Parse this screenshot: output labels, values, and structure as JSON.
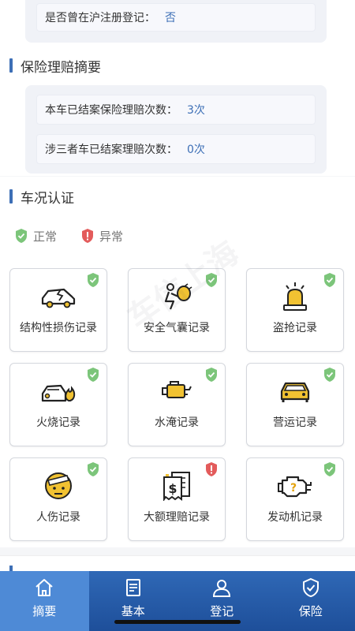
{
  "top_row": {
    "label": "是否曾在沪注册登记：",
    "value": "否"
  },
  "insurance": {
    "title": "保险理赔摘要",
    "rows": [
      {
        "label": "本车已结案保险理赔次数：",
        "value": "3次"
      },
      {
        "label": "涉三者车已结案理赔次数：",
        "value": "0次"
      }
    ]
  },
  "condition": {
    "title": "车况认证",
    "legend": {
      "normal": "正常",
      "abnormal": "异常"
    },
    "tiles": [
      {
        "label": "结构性损伤记录",
        "icon": "car-damage-icon",
        "status": "normal"
      },
      {
        "label": "安全气囊记录",
        "icon": "airbag-icon",
        "status": "normal"
      },
      {
        "label": "盗抢记录",
        "icon": "alarm-light-icon",
        "status": "normal"
      },
      {
        "label": "火烧记录",
        "icon": "car-fire-icon",
        "status": "normal"
      },
      {
        "label": "水淹记录",
        "icon": "engine-oil-icon",
        "status": "normal"
      },
      {
        "label": "营运记录",
        "icon": "taxi-icon",
        "status": "normal"
      },
      {
        "label": "人伤记录",
        "icon": "injured-face-icon",
        "status": "normal"
      },
      {
        "label": "大额理赔记录",
        "icon": "bill-icon",
        "status": "abnormal"
      },
      {
        "label": "发动机记录",
        "icon": "engine-warning-icon",
        "status": "normal"
      }
    ]
  },
  "watermark": "车信上海",
  "nav": {
    "items": [
      {
        "label": "摘要",
        "icon": "home-icon"
      },
      {
        "label": "基本",
        "icon": "document-icon"
      },
      {
        "label": "登记",
        "icon": "user-icon"
      },
      {
        "label": "保险",
        "icon": "shield-check-icon"
      }
    ],
    "active": "摘要"
  },
  "colors": {
    "accent": "#3d6fb6",
    "ok": "#7cc57a",
    "warn": "#e35b5b",
    "nav": "#2f68b6"
  }
}
